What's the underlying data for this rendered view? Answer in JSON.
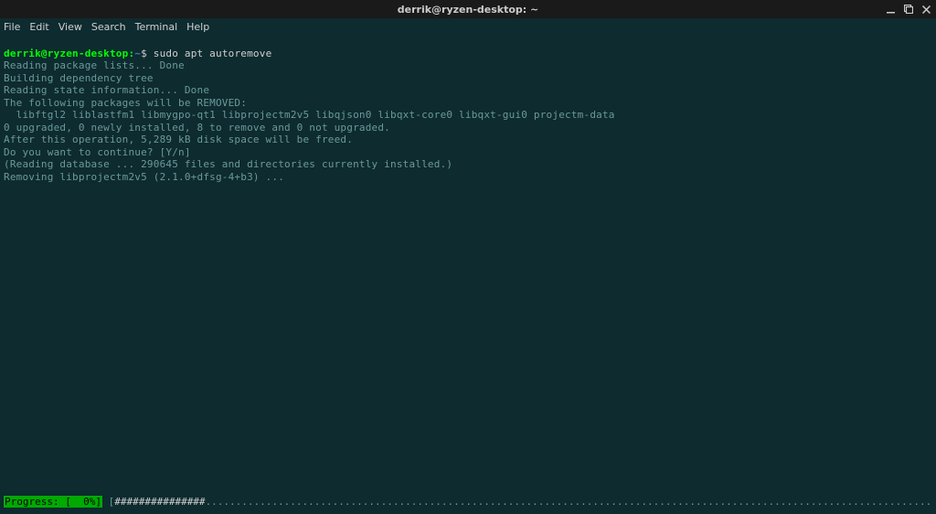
{
  "window": {
    "title": "derrik@ryzen-desktop: ~"
  },
  "menu": {
    "file": "File",
    "edit": "Edit",
    "view": "View",
    "search": "Search",
    "terminal": "Terminal",
    "help": "Help"
  },
  "prompt": {
    "user_host": "derrik@ryzen-desktop",
    "path": "~",
    "symbol": "$"
  },
  "command": "sudo apt autoremove",
  "output": {
    "l1": "Reading package lists... Done",
    "l2": "Building dependency tree",
    "l3": "Reading state information... Done",
    "l4": "The following packages will be REMOVED:",
    "l5": "  libftgl2 liblastfm1 libmygpo-qt1 libprojectm2v5 libqjson0 libqxt-core0 libqxt-gui0 projectm-data",
    "l6": "0 upgraded, 0 newly installed, 8 to remove and 0 not upgraded.",
    "l7": "After this operation, 5,289 kB disk space will be freed.",
    "l8": "Do you want to continue? [Y/n]",
    "l9": "(Reading database ... 290645 files and directories currently installed.)",
    "l10": "Removing libprojectm2v5 (2.1.0+dfsg-4+b3) ..."
  },
  "progress": {
    "label": "Progress: [  0%]",
    "bar_fill": "###############",
    "bar_empty": "........................................................................................................................................................................................]"
  }
}
